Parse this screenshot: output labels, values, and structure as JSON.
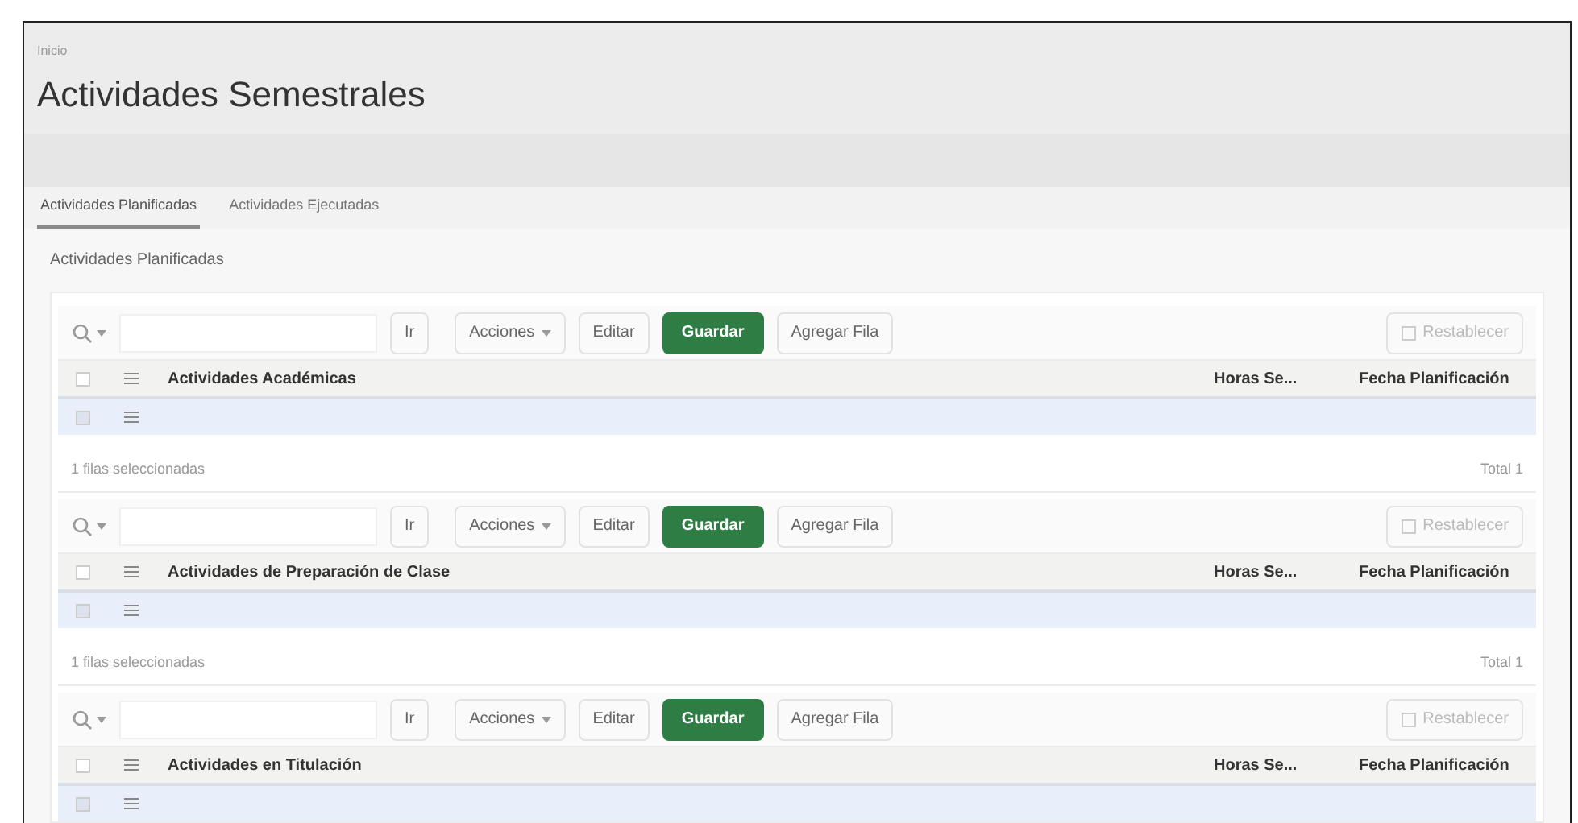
{
  "breadcrumb": "Inicio",
  "title": "Actividades Semestrales",
  "tabs": [
    {
      "label": "Actividades Planificadas",
      "selected": true
    },
    {
      "label": "Actividades Ejecutadas",
      "selected": false
    }
  ],
  "region_title": "Actividades Planificadas",
  "grids": [
    {
      "toolbar": {
        "go": "Ir",
        "actions": "Acciones",
        "edit": "Editar",
        "save": "Guardar",
        "add_row": "Agregar Fila",
        "reset": "Restablecer"
      },
      "all_selected": false,
      "columns": [
        "Actividades Académicas",
        "Horas Se...",
        "Fecha Planificación"
      ],
      "rows": [
        {
          "selected": true
        }
      ],
      "footer": {
        "selection": "1 filas seleccionadas",
        "total": "Total 1"
      }
    },
    {
      "toolbar": {
        "go": "Ir",
        "actions": "Acciones",
        "edit": "Editar",
        "save": "Guardar",
        "add_row": "Agregar Fila",
        "reset": "Restablecer"
      },
      "all_selected": false,
      "columns": [
        "Actividades de Preparación de Clase",
        "Horas Se...",
        "Fecha Planificación"
      ],
      "rows": [
        {
          "selected": true
        }
      ],
      "footer": {
        "selection": "1 filas seleccionadas",
        "total": "Total 1"
      }
    },
    {
      "toolbar": {
        "go": "Ir",
        "actions": "Acciones",
        "edit": "Editar",
        "save": "Guardar",
        "add_row": "Agregar Fila",
        "reset": "Restablecer"
      },
      "all_selected": false,
      "columns": [
        "Actividades en Titulación",
        "Horas Se...",
        "Fecha Planificación"
      ],
      "rows": [
        {
          "selected": true
        }
      ]
    }
  ]
}
